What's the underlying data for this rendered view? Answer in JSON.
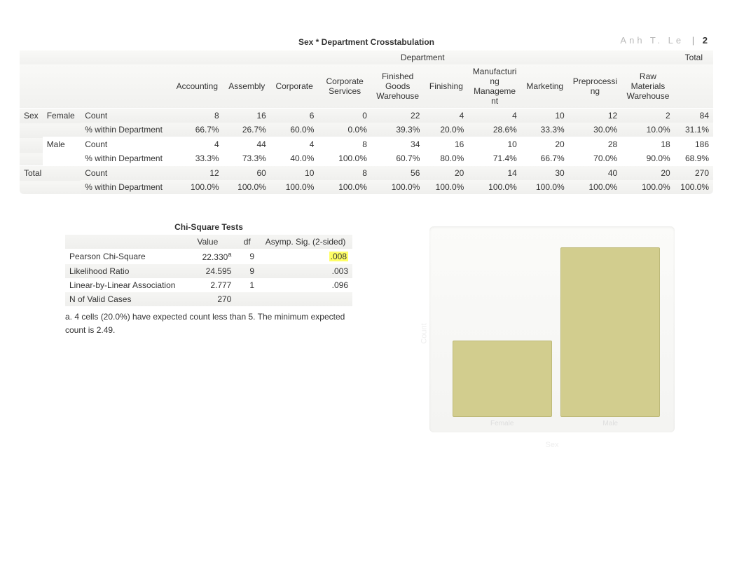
{
  "header": {
    "author": "Anh T. Le",
    "pipe": "|",
    "page": "2"
  },
  "crosstab": {
    "title": "Sex * Department Crosstabulation",
    "group_label": "Department",
    "total_label": "Total",
    "corner_row": "Sex",
    "columns": [
      "Accounting",
      "Assembly",
      "Corporate",
      "Corporate Services",
      "Finished Goods Warehouse",
      "Finishing",
      "Manufacturing Management",
      "Marketing",
      "Preprocessing",
      "Raw Materials Warehouse"
    ],
    "stat_labels": {
      "count": "Count",
      "pct": "% within Department"
    },
    "rows": [
      {
        "cat": "Female",
        "count": [
          "8",
          "16",
          "6",
          "0",
          "22",
          "4",
          "4",
          "10",
          "12",
          "2",
          "84"
        ],
        "pct": [
          "66.7%",
          "26.7%",
          "60.0%",
          "0.0%",
          "39.3%",
          "20.0%",
          "28.6%",
          "33.3%",
          "30.0%",
          "10.0%",
          "31.1%"
        ]
      },
      {
        "cat": "Male",
        "count": [
          "4",
          "44",
          "4",
          "8",
          "34",
          "16",
          "10",
          "20",
          "28",
          "18",
          "186"
        ],
        "pct": [
          "33.3%",
          "73.3%",
          "40.0%",
          "100.0%",
          "60.7%",
          "80.0%",
          "71.4%",
          "66.7%",
          "70.0%",
          "90.0%",
          "68.9%"
        ]
      }
    ],
    "total": {
      "label": "Total",
      "count": [
        "12",
        "60",
        "10",
        "8",
        "56",
        "20",
        "14",
        "30",
        "40",
        "20",
        "270"
      ],
      "pct": [
        "100.0%",
        "100.0%",
        "100.0%",
        "100.0%",
        "100.0%",
        "100.0%",
        "100.0%",
        "100.0%",
        "100.0%",
        "100.0%",
        "100.0%"
      ]
    }
  },
  "chisq": {
    "title": "Chi-Square Tests",
    "headers": [
      "",
      "Value",
      "df",
      "Asymp. Sig. (2-sided)"
    ],
    "rows": [
      {
        "label": "Pearson Chi-Square",
        "value": "22.330",
        "sup": "a",
        "df": "9",
        "sig": ".008",
        "highlight_sig": true
      },
      {
        "label": "Likelihood Ratio",
        "value": "24.595",
        "sup": "",
        "df": "9",
        "sig": ".003",
        "highlight_sig": false
      },
      {
        "label": "Linear-by-Linear Association",
        "value": "2.777",
        "sup": "",
        "df": "1",
        "sig": ".096",
        "highlight_sig": false
      },
      {
        "label": "N of Valid Cases",
        "value": "270",
        "sup": "",
        "df": "",
        "sig": "",
        "highlight_sig": false
      }
    ],
    "footnote": "a. 4 cells (20.0%) have expected count less than 5. The minimum expected count is 2.49."
  },
  "chart_data": {
    "type": "bar",
    "categories": [
      "Female",
      "Male"
    ],
    "values": [
      84,
      186
    ],
    "title": "",
    "xlabel": "Sex",
    "ylabel": "Count",
    "ylim": [
      0,
      200
    ]
  }
}
